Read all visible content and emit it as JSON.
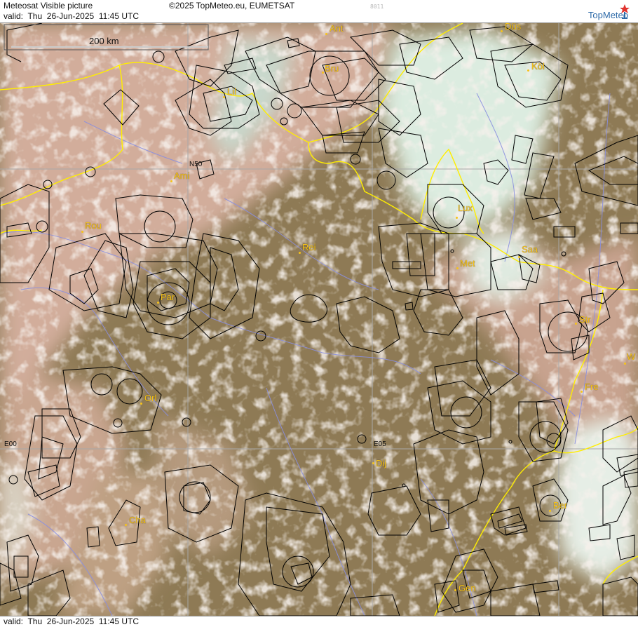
{
  "header": {
    "title": "Meteosat Visible picture",
    "valid": "valid:  Thu  26-Jun-2025  11:45 UTC",
    "copyright": "©2025 TopMeteo.eu, EUMETSAT",
    "code": "8011",
    "logo": "TopMeteo"
  },
  "footer": {
    "valid": "valid:  Thu  26-Jun-2025  11:45 UTC"
  },
  "scale": {
    "label": "200 km"
  },
  "grid_labels": {
    "n50": "N50",
    "e00": "E00",
    "e05": "E05"
  },
  "cities": [
    {
      "id": "ant",
      "label": "Ant"
    },
    {
      "id": "dus",
      "label": "Düs"
    },
    {
      "id": "bru",
      "label": "Bru"
    },
    {
      "id": "kol",
      "label": "Köl"
    },
    {
      "id": "lil",
      "label": "Lil"
    },
    {
      "id": "ami",
      "label": "Ami"
    },
    {
      "id": "rou",
      "label": "Rou"
    },
    {
      "id": "lux",
      "label": "Lux"
    },
    {
      "id": "rei",
      "label": "Rei"
    },
    {
      "id": "saa",
      "label": "Saa"
    },
    {
      "id": "met",
      "label": "Met"
    },
    {
      "id": "par",
      "label": "Par"
    },
    {
      "id": "str",
      "label": "Str"
    },
    {
      "id": "w",
      "label": "W"
    },
    {
      "id": "fre",
      "label": "Fre"
    },
    {
      "id": "orl",
      "label": "Orl"
    },
    {
      "id": "dij",
      "label": "Dij"
    },
    {
      "id": "ber",
      "label": "Ber"
    },
    {
      "id": "cha",
      "label": "Cha"
    },
    {
      "id": "gen",
      "label": "Gen"
    }
  ],
  "colors": {
    "land": "#8e7a55",
    "haze": "#d9b7a8",
    "cloud": "#dfeee3",
    "border": "#ffee00",
    "river": "#8a8fe0",
    "airspace": "#000000",
    "city": "#f6c31a"
  },
  "icons": {
    "logo": "topmeteo-logo-icon"
  }
}
